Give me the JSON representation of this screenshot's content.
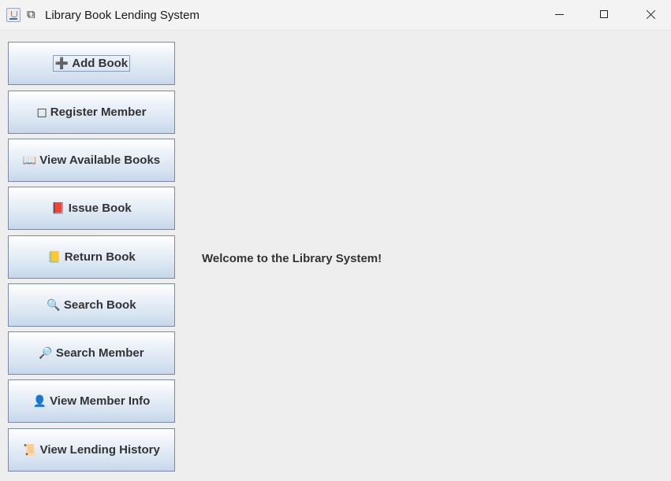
{
  "window": {
    "title_icon": "books-icon",
    "title": "Library Book Lending System"
  },
  "sidebar": {
    "buttons": [
      {
        "icon": "➕",
        "icon_name": "plus-icon",
        "label": "Add Book"
      },
      {
        "icon": "□",
        "icon_name": "member-icon",
        "label": "Register Member"
      },
      {
        "icon": "📖",
        "icon_name": "open-book-icon",
        "label": "View Available Books"
      },
      {
        "icon": "📕",
        "icon_name": "closed-book-icon",
        "label": "Issue Book"
      },
      {
        "icon": "📒",
        "icon_name": "ledger-icon",
        "label": "Return Book"
      },
      {
        "icon": "🔍",
        "icon_name": "magnifier-icon",
        "label": "Search Book"
      },
      {
        "icon": "🔎",
        "icon_name": "magnifier-right-icon",
        "label": "Search Member"
      },
      {
        "icon": "👤",
        "icon_name": "person-icon",
        "label": "View Member Info"
      },
      {
        "icon": "📜",
        "icon_name": "scroll-icon",
        "label": "View Lending History"
      }
    ]
  },
  "main": {
    "welcome": "Welcome to the Library System!"
  }
}
